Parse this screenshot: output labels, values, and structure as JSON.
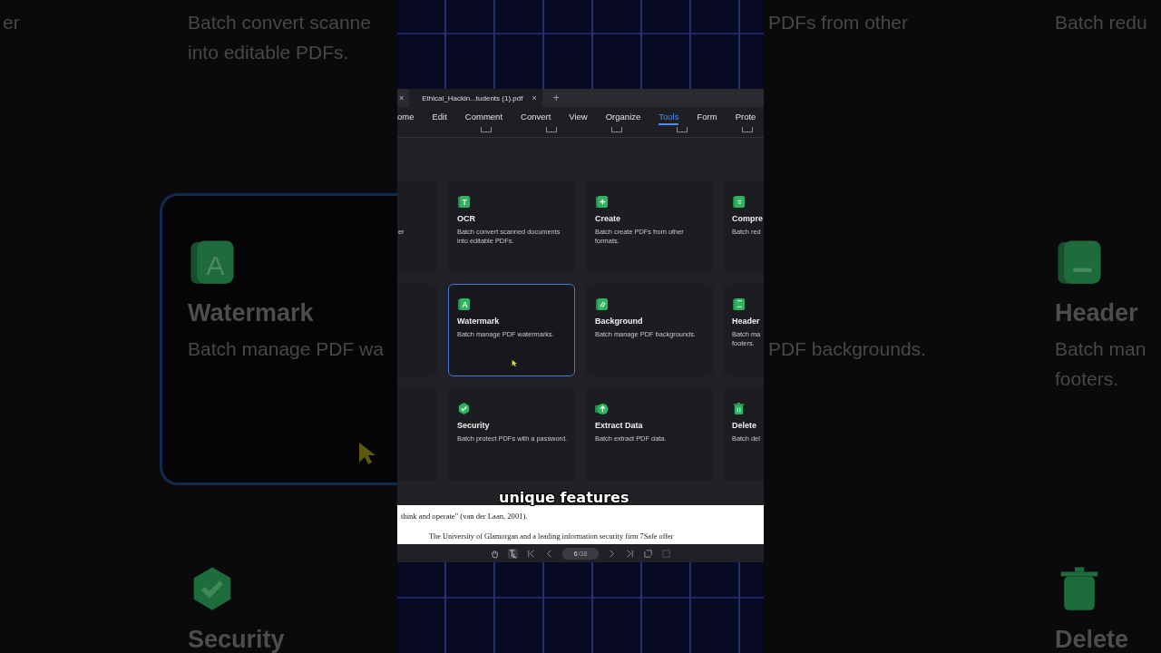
{
  "backdrop_left": [
    {
      "cells": [
        {
          "lines": [
            "er"
          ]
        },
        {},
        {}
      ]
    },
    {
      "cells": [
        {
          "lines": [
            "Batch convert scanne",
            "into editable PDFs."
          ]
        },
        {
          "kind": "watermark",
          "icon_letter": "A",
          "title": "Watermark",
          "lines": [
            "Batch manage PDF wa"
          ],
          "selected": true,
          "cursor": true
        },
        {
          "kind": "security",
          "title": "Security"
        }
      ]
    }
  ],
  "backdrop_right": [
    {
      "cells": [
        {
          "lines": [
            "PDFs from other"
          ]
        },
        {
          "lines": [
            "PDF backgrounds."
          ]
        },
        {}
      ]
    },
    {
      "cells": [
        {
          "lines": [
            "Batch redu"
          ]
        },
        {
          "kind": "header",
          "title": "Header",
          "lines": [
            "Batch man",
            "footers."
          ]
        },
        {
          "kind": "delete",
          "title": "Delete"
        }
      ]
    }
  ],
  "tab_bar": {
    "close_left": "×",
    "tab": {
      "title": "Ethical_Hackin...tudents (1).pdf",
      "close": "×"
    },
    "new_tab": "+"
  },
  "menu": [
    {
      "label": "ome",
      "selected": false
    },
    {
      "label": "Edit",
      "selected": false
    },
    {
      "label": "Comment",
      "selected": false
    },
    {
      "label": "Convert",
      "selected": false
    },
    {
      "label": "View",
      "selected": false
    },
    {
      "label": "Organize",
      "selected": false
    },
    {
      "label": "Tools",
      "selected": true
    },
    {
      "label": "Form",
      "selected": false
    },
    {
      "label": "Prote",
      "selected": false
    }
  ],
  "tool_rows": [
    [
      {
        "lines": [
          "er"
        ]
      },
      {
        "kind": "ocr",
        "icon_letter": "T",
        "title": "OCR",
        "lines": [
          "Batch convert scanned documents",
          "into editable PDFs."
        ],
        "selected": false
      },
      {
        "kind": "create",
        "title": "Create",
        "lines": [
          "Batch create PDFs from other",
          "formats."
        ],
        "selected": false
      },
      {
        "kind": "compress",
        "title": "Compre",
        "lines": [
          "Batch red"
        ],
        "selected": false
      }
    ],
    [
      {},
      {
        "kind": "watermark",
        "icon_letter": "A",
        "title": "Watermark",
        "lines": [
          "Batch manage PDF watermarks."
        ],
        "selected": true,
        "cursor": true
      },
      {
        "kind": "background",
        "title": "Background",
        "lines": [
          "Batch manage PDF backgrounds."
        ],
        "selected": false
      },
      {
        "kind": "header",
        "title": "Header",
        "lines": [
          "Batch ma",
          "footers."
        ],
        "selected": false
      }
    ],
    [
      {},
      {
        "kind": "security",
        "title": "Security",
        "lines": [
          "Batch protect PDFs with a password."
        ],
        "selected": false
      },
      {
        "kind": "extract",
        "title": "Extract Data",
        "lines": [
          "Batch extract PDF data."
        ],
        "selected": false
      },
      {
        "kind": "delete",
        "title": "Delete",
        "lines": [
          "Batch del"
        ],
        "selected": false
      }
    ]
  ],
  "document": {
    "lines": [
      {
        "kind": "plain",
        "text": "think and operate\" (van der Laan, 2001)."
      },
      {
        "kind": "indented",
        "text": "The University of Glamorgan and a leading information security firm 7Safe offer"
      }
    ]
  },
  "page_nav": {
    "page": "6",
    "total": "/38"
  },
  "caption": "unique features"
}
